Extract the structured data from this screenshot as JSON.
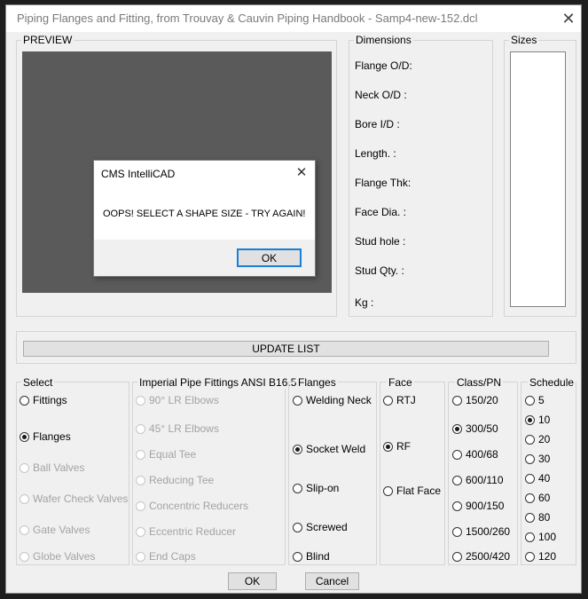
{
  "window": {
    "title": "Piping Flanges and Fitting, from Trouvay & Cauvin Piping Handbook - Samp4-new-152.dcl",
    "close_glyph": "✕"
  },
  "preview": {
    "title": "PREVIEW"
  },
  "dimensions": {
    "title": "Dimensions",
    "labels": [
      "Flange O/D:",
      "Neck O/D  :",
      "Bore I/D    :",
      "Length.      :",
      "Flange Thk:",
      "Face Dia.   :",
      "Stud hole   :",
      "Stud Qty.    :",
      "Kg             :"
    ]
  },
  "sizes": {
    "title": "Sizes"
  },
  "update_button": "UPDATE LIST",
  "select_group": {
    "title": "Select",
    "options": [
      {
        "label": "Fittings",
        "checked": false,
        "enabled": true
      },
      {
        "label": "Flanges",
        "checked": true,
        "enabled": true
      },
      {
        "label": "Ball Valves",
        "checked": false,
        "enabled": false
      },
      {
        "label": "Wafer Check Valves",
        "checked": false,
        "enabled": false
      },
      {
        "label": "Gate Valves",
        "checked": false,
        "enabled": false
      },
      {
        "label": "Globe Valves",
        "checked": false,
        "enabled": false
      }
    ]
  },
  "fittings_group": {
    "title": "Imperial Pipe Fittings ANSI B16.5",
    "options": [
      {
        "label": "90° LR Elbows",
        "checked": false,
        "enabled": false
      },
      {
        "label": "45° LR Elbows",
        "checked": false,
        "enabled": false
      },
      {
        "label": "Equal Tee",
        "checked": false,
        "enabled": false
      },
      {
        "label": "Reducing Tee",
        "checked": false,
        "enabled": false
      },
      {
        "label": "Concentric Reducers",
        "checked": false,
        "enabled": false
      },
      {
        "label": "Eccentric Reducer",
        "checked": false,
        "enabled": false
      },
      {
        "label": "End Caps",
        "checked": false,
        "enabled": false
      }
    ]
  },
  "flanges_group": {
    "title": "Flanges",
    "options": [
      {
        "label": "Welding Neck",
        "checked": false,
        "enabled": true
      },
      {
        "label": "Socket Weld",
        "checked": true,
        "enabled": true
      },
      {
        "label": "Slip-on",
        "checked": false,
        "enabled": true
      },
      {
        "label": "Screwed",
        "checked": false,
        "enabled": true
      },
      {
        "label": "Blind",
        "checked": false,
        "enabled": true
      }
    ]
  },
  "face_group": {
    "title": "Face",
    "options": [
      {
        "label": "RTJ",
        "checked": false,
        "enabled": true
      },
      {
        "label": "RF",
        "checked": true,
        "enabled": true
      },
      {
        "label": "Flat Face",
        "checked": false,
        "enabled": true
      }
    ]
  },
  "class_group": {
    "title": "Class/PN",
    "options": [
      {
        "label": "150/20",
        "checked": false,
        "enabled": true
      },
      {
        "label": "300/50",
        "checked": true,
        "enabled": true
      },
      {
        "label": "400/68",
        "checked": false,
        "enabled": true
      },
      {
        "label": "600/110",
        "checked": false,
        "enabled": true
      },
      {
        "label": "900/150",
        "checked": false,
        "enabled": true
      },
      {
        "label": "1500/260",
        "checked": false,
        "enabled": true
      },
      {
        "label": "2500/420",
        "checked": false,
        "enabled": true
      }
    ]
  },
  "schedule_group": {
    "title": "Schedule",
    "options": [
      {
        "label": "5",
        "checked": false,
        "enabled": true
      },
      {
        "label": "10",
        "checked": true,
        "enabled": true
      },
      {
        "label": "20",
        "checked": false,
        "enabled": true
      },
      {
        "label": "30",
        "checked": false,
        "enabled": true
      },
      {
        "label": "40",
        "checked": false,
        "enabled": true
      },
      {
        "label": "60",
        "checked": false,
        "enabled": true
      },
      {
        "label": "80",
        "checked": false,
        "enabled": true
      },
      {
        "label": "100",
        "checked": false,
        "enabled": true
      },
      {
        "label": "120",
        "checked": false,
        "enabled": true
      }
    ]
  },
  "buttons": {
    "ok": "OK",
    "cancel": "Cancel"
  },
  "message_box": {
    "title": "CMS IntelliCAD",
    "close_glyph": "✕",
    "message": "OOPS! SELECT A SHAPE SIZE - TRY AGAIN!",
    "ok": "OK"
  }
}
